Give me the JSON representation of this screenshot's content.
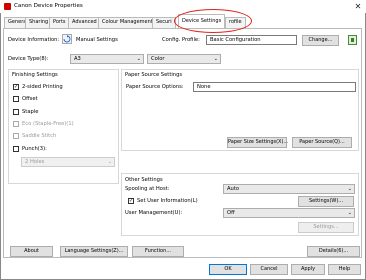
{
  "window": {
    "title": "Canon Device Properties"
  },
  "tabs": [
    {
      "label": "General"
    },
    {
      "label": "Sharing"
    },
    {
      "label": "Ports"
    },
    {
      "label": "Advanced"
    },
    {
      "label": "Colour Management"
    },
    {
      "label": "Securi"
    },
    {
      "label": "Device Settings"
    },
    {
      "label": "rofile"
    }
  ],
  "device_info": {
    "label": "Device Information:",
    "value": "Manual Settings",
    "config_profile_label": "Config. Profile:",
    "config_profile_value": "Basic Configuration",
    "change_button": "Change..."
  },
  "device_type": {
    "label": "Device Type(8):",
    "model_value": "A3",
    "color_value": "Color"
  },
  "finishing": {
    "title": "Finishing Settings",
    "options": [
      {
        "label": "2-sided Printing",
        "checked": true,
        "enabled": true
      },
      {
        "label": "Offset",
        "checked": false,
        "enabled": true
      },
      {
        "label": "Staple",
        "checked": false,
        "enabled": true
      },
      {
        "label": "Eco (Staple-Free)(1)",
        "checked": false,
        "enabled": false
      },
      {
        "label": "Saddle Stitch",
        "checked": false,
        "enabled": false
      },
      {
        "label": "Punch(3):",
        "checked": false,
        "enabled": true
      }
    ],
    "punch_select": "2 Holes"
  },
  "paper_source": {
    "title": "Paper Source Settings",
    "options_label": "Paper Source Options:",
    "options_value": "None",
    "paper_size_button": "Paper Size Settings(X)...",
    "paper_source_button": "Paper Source(Q)..."
  },
  "other": {
    "title": "Other Settings",
    "spooling_label": "Spooling at Host:",
    "spooling_value": "Auto",
    "user_info_label": "Set User Information(L)",
    "user_info_checked": true,
    "settings_button": "Settings(W)...",
    "user_mgmt_label": "User Management(U):",
    "user_mgmt_value": "Off",
    "settings_disabled_button": "Settings..."
  },
  "bottom_buttons": {
    "about": "About",
    "language": "Language Settings(Z)...",
    "function": "Function...",
    "details": "Details(6)..."
  },
  "dialog_buttons": {
    "ok": "OK",
    "cancel": "Cancel",
    "apply": "Apply",
    "help": "Help"
  },
  "colors": {
    "highlight": "#e0221a",
    "accent": "#0078d7"
  }
}
